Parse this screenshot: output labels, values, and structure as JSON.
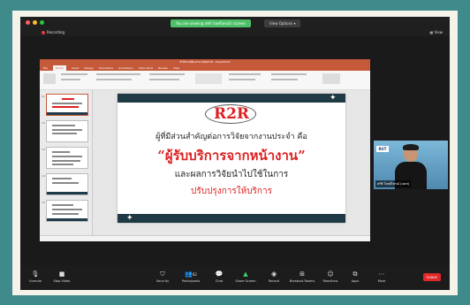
{
  "top_bar": {
    "share_notice": "You are viewing สรัชิ โจทย์ไทรณ์'s screen",
    "view_options": "View Options",
    "recording": "Recording",
    "view": "View"
  },
  "ppt": {
    "title": "สำนักงานพัฒนาระบบสุขภาพ - PowerPoint",
    "tabs": [
      "File",
      "Home",
      "Insert",
      "Design",
      "Transitions",
      "Animations",
      "Slide Show",
      "Review",
      "View"
    ],
    "thumb_numbers": [
      "11",
      "12",
      "13",
      "14",
      "15"
    ]
  },
  "slide": {
    "heading": "R2R",
    "line1": "ผู้ที่มีส่วนสำคัญต่อการวิจัยจากงานประจำ คือ",
    "line2": "“ผู้รับบริการจากหน้างาน”",
    "line3": "และผลการวิจัยนำไปใช้ในการ",
    "line4": "ปรับปรุงการให้บริการ",
    "colors": {
      "heading": "#dd2222",
      "bar": "#1f3a44"
    }
  },
  "video": {
    "name": "สรัชิ โจทย์ไทรณ์ (usm)",
    "logo": "RUT"
  },
  "toolbar": {
    "unmute": "Unmute",
    "stop_video": "Stop Video",
    "security": "Security",
    "participants": "Participants",
    "participants_count": "82",
    "chat": "Chat",
    "share_screen": "Share Screen",
    "record": "Record",
    "breakout": "Breakout Rooms",
    "reactions": "Reactions",
    "apps": "Apps",
    "more": "More",
    "leave": "Leave"
  }
}
